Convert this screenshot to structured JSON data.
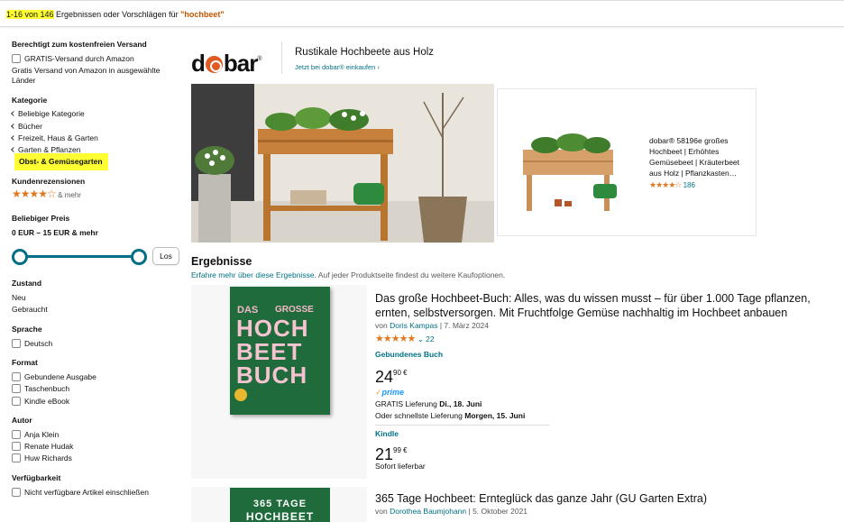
{
  "header": {
    "count_range": "1-16 von 146",
    "count_text": " Ergebnissen oder Vorschlägen für ",
    "query": "\"hochbeet\""
  },
  "sidebar": {
    "shipping_heading": "Berechtigt zum kostenfreien Versand",
    "shipping_option": "GRATIS-Versand durch Amazon",
    "shipping_note_1": "Gratis Versand von Amazon in ausgewählte",
    "shipping_note_2": "Länder",
    "category_heading": "Kategorie",
    "categories": [
      "Beliebige Kategorie",
      "Bücher",
      "Freizeit, Haus & Garten",
      "Garten & Pflanzen"
    ],
    "category_selected": "Obst- & Gemüsegarten",
    "reviews_heading": "Kundenrezensionen",
    "reviews_stars": "★★★★☆",
    "reviews_suffix": "& mehr",
    "price_heading": "Beliebiger Preis",
    "price_range": "0 EUR – 15 EUR & mehr",
    "price_button": "Los",
    "condition_heading": "Zustand",
    "conditions": [
      "Neu",
      "Gebraucht"
    ],
    "language_heading": "Sprache",
    "languages": [
      "Deutsch"
    ],
    "format_heading": "Format",
    "formats": [
      "Gebundene Ausgabe",
      "Taschenbuch",
      "Kindle eBook"
    ],
    "author_heading": "Autor",
    "authors": [
      "Anja Klein",
      "Renate Hudak",
      "Huw Richards"
    ],
    "availability_heading": "Verfügbarkeit",
    "availability_option": "Nicht verfügbare Artikel einschließen"
  },
  "brand": {
    "logo": "dobar",
    "title": "Rustikale Hochbeete aus Holz",
    "link": "Jetzt bei dobar® einkaufen ›",
    "product_text": "dobar® 58196e großes Hochbeet | Erhöhtes Gemüsebeet | Kräuterbeet aus Holz | Pflanzkasten…",
    "product_stars": "★★★★☆",
    "product_reviews": "186"
  },
  "results": {
    "heading": "Ergebnisse",
    "sub_link": "Erfahre mehr über diese Ergebnisse.",
    "sub_text": " Auf jeder Produktseite findest du weitere Kaufoptionen.",
    "items": [
      {
        "title": "Das große Hochbeet-Buch: Alles, was du wissen musst – für über 1.000 Tage pflanzen, ernten, selbstversorgen. Mit Fruchtfolge Gemüse nachhaltig im Hochbeet anbauen",
        "by": "von ",
        "author": "Doris Kampas",
        "date": " | 7. März 2024",
        "stars": "★★★★★",
        "reviews": "⌄ 22",
        "format1": "Gebundenes Buch",
        "price1_main": "24",
        "price1_frac": "90 €",
        "prime": "prime",
        "delivery_prefix": "GRATIS Lieferung ",
        "delivery_date": "Di., 18. Juni",
        "fast_prefix": "Oder schnellste Lieferung ",
        "fast_date": "Morgen, 15. Juni",
        "format2": "Kindle",
        "price2_main": "21",
        "price2_frac": "99 €",
        "availability": "Sofort lieferbar",
        "cover_small_1": "DAS",
        "cover_small_2": "GROSSE",
        "cover_line_1": "HOCH",
        "cover_line_2": "BEET",
        "cover_line_3": "BUCH"
      },
      {
        "title": "365 Tage Hochbeet: Ernteglück das ganze Jahr (GU Garten Extra)",
        "by": "von ",
        "author": "Dorothea Baumjohann",
        "date": " | 5. Oktober 2021",
        "cover_line_1": "365 TAGE",
        "cover_line_2": "HOCHBEET"
      }
    ]
  },
  "colors": {
    "link": "#007185",
    "highlight": "#ffff33",
    "star": "#de7921",
    "query": "#c45500",
    "prime": "#1a98ff"
  }
}
